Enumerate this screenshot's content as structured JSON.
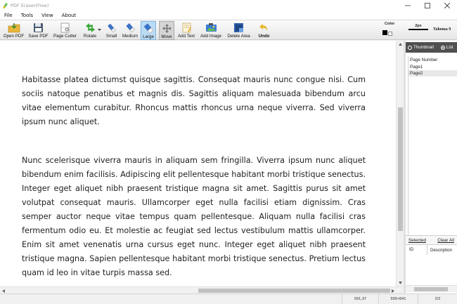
{
  "window": {
    "title": "PDF Eraser(Free)"
  },
  "menu": {
    "items": [
      "File",
      "Tools",
      "View",
      "About"
    ]
  },
  "toolbar": {
    "buttons": [
      {
        "label": "Open PDF"
      },
      {
        "label": "Save PDF"
      },
      {
        "label": "Page Cutter"
      },
      {
        "label": "Rotate"
      },
      {
        "label": "Small"
      },
      {
        "label": "Medium"
      },
      {
        "label": "Large"
      },
      {
        "label": "Move"
      },
      {
        "label": "Add Text"
      },
      {
        "label": "Add Image"
      },
      {
        "label": "Delete Area"
      },
      {
        "label": "Undo"
      }
    ],
    "color_label": "Color",
    "size_label": "2px",
    "font_label": "Tahoma 9",
    "colors": {
      "primary": "#000000",
      "secondary": "#ffffff"
    }
  },
  "document": {
    "paragraphs": [
      "Habitasse platea dictumst quisque sagittis. Consequat mauris nunc congue nisi. Cum sociis natoque penatibus et magnis dis. Sagittis aliquam malesuada bibendum arcu vitae elementum curabitur. Rhoncus mattis rhoncus urna neque viverra. Sed viverra ipsum nunc aliquet.",
      "Nunc scelerisque viverra mauris in aliquam sem fringilla. Viverra ipsum nunc aliquet bibendum enim facilisis. Adipiscing elit pellentesque habitant morbi tristique senectus. Integer eget aliquet nibh praesent tristique magna sit amet. Sagittis purus sit amet volutpat consequat mauris. Ullamcorper eget nulla facilisi etiam dignissim. Cras semper auctor neque vitae tempus quam pellentesque. Aliquam nulla facilisi cras fermentum odio eu. Et molestie ac feugiat sed lectus vestibulum mattis ullamcorper. Enim sit amet venenatis urna cursus eget nunc. Integer eget aliquet nibh praesent tristique magna. Sapien pellentesque habitant morbi tristique senectus. Pretium lectus quam id leo in vitae turpis massa sed."
    ]
  },
  "side_panel": {
    "view_options": [
      "Thumbnail",
      "List"
    ],
    "selected_view": "List",
    "page_header": "Page Number",
    "pages": [
      "Page1",
      "Page2"
    ],
    "selected_link": "Selected",
    "clear_link": "Clear All",
    "columns": [
      "ID",
      "Description"
    ]
  },
  "status": {
    "cursor": "591,37",
    "page_size": "595×841",
    "page_index": "2/2"
  }
}
